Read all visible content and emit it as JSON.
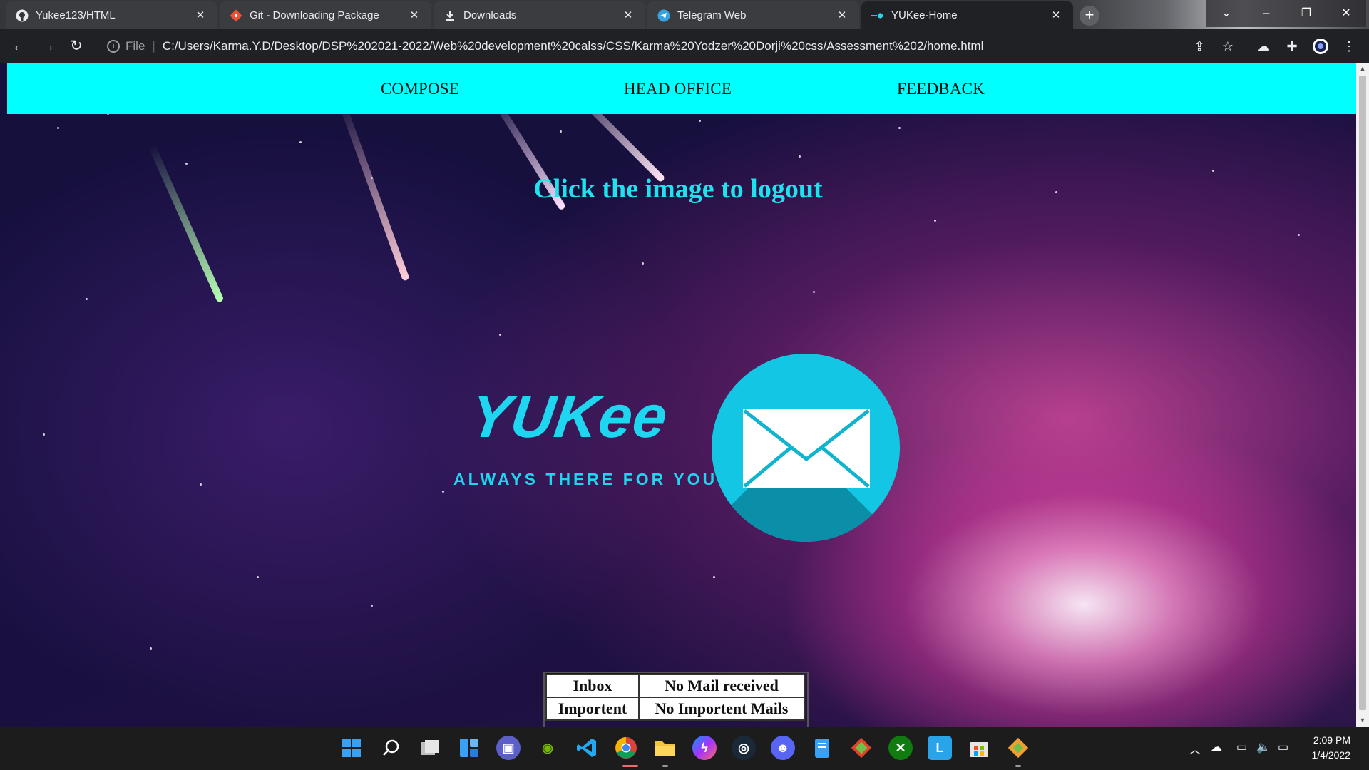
{
  "browser": {
    "tabs": [
      {
        "title": "Yukee123/HTML",
        "icon": "github-icon",
        "active": false
      },
      {
        "title": "Git - Downloading Package",
        "icon": "git-icon",
        "active": false
      },
      {
        "title": "Downloads",
        "icon": "download-icon",
        "active": false
      },
      {
        "title": "Telegram Web",
        "icon": "telegram-icon",
        "active": false
      },
      {
        "title": "YUKee-Home",
        "icon": "page-icon",
        "active": true
      }
    ],
    "address": {
      "scheme_label": "File",
      "url": "C:/Users/Karma.Y.D/Desktop/DSP%202021-2022/Web%20development%20calss/CSS/Karma%20Yodzer%20Dorji%20css/Assessment%202/home.html"
    }
  },
  "page": {
    "nav": {
      "compose": "COMPOSE",
      "head_office": "HEAD OFFICE",
      "feedback": "FEEDBACK"
    },
    "heading": "Click the image to logout",
    "logo": {
      "word": "YUKee",
      "tagline": "ALWAYS THERE FOR YOU"
    },
    "mail_table": [
      {
        "label": "Inbox",
        "value": "No Mail received"
      },
      {
        "label": "Importent",
        "value": "No Importent Mails"
      }
    ],
    "colors": {
      "navbar": "#00ffff",
      "accent": "#1fd6f0"
    }
  },
  "taskbar": {
    "apps": [
      "start-icon",
      "search-icon",
      "task-view-icon",
      "widgets-icon",
      "teams-chat-icon",
      "nvidia-icon",
      "vscode-icon",
      "chrome-icon",
      "file-explorer-icon",
      "messenger-icon",
      "steam-icon",
      "discord-icon",
      "notepad-icon",
      "git-gui-icon",
      "xbox-icon",
      "l-app-icon",
      "store-icon",
      "git-icon"
    ],
    "clock": {
      "time": "2:09 PM",
      "date": "1/4/2022"
    }
  }
}
